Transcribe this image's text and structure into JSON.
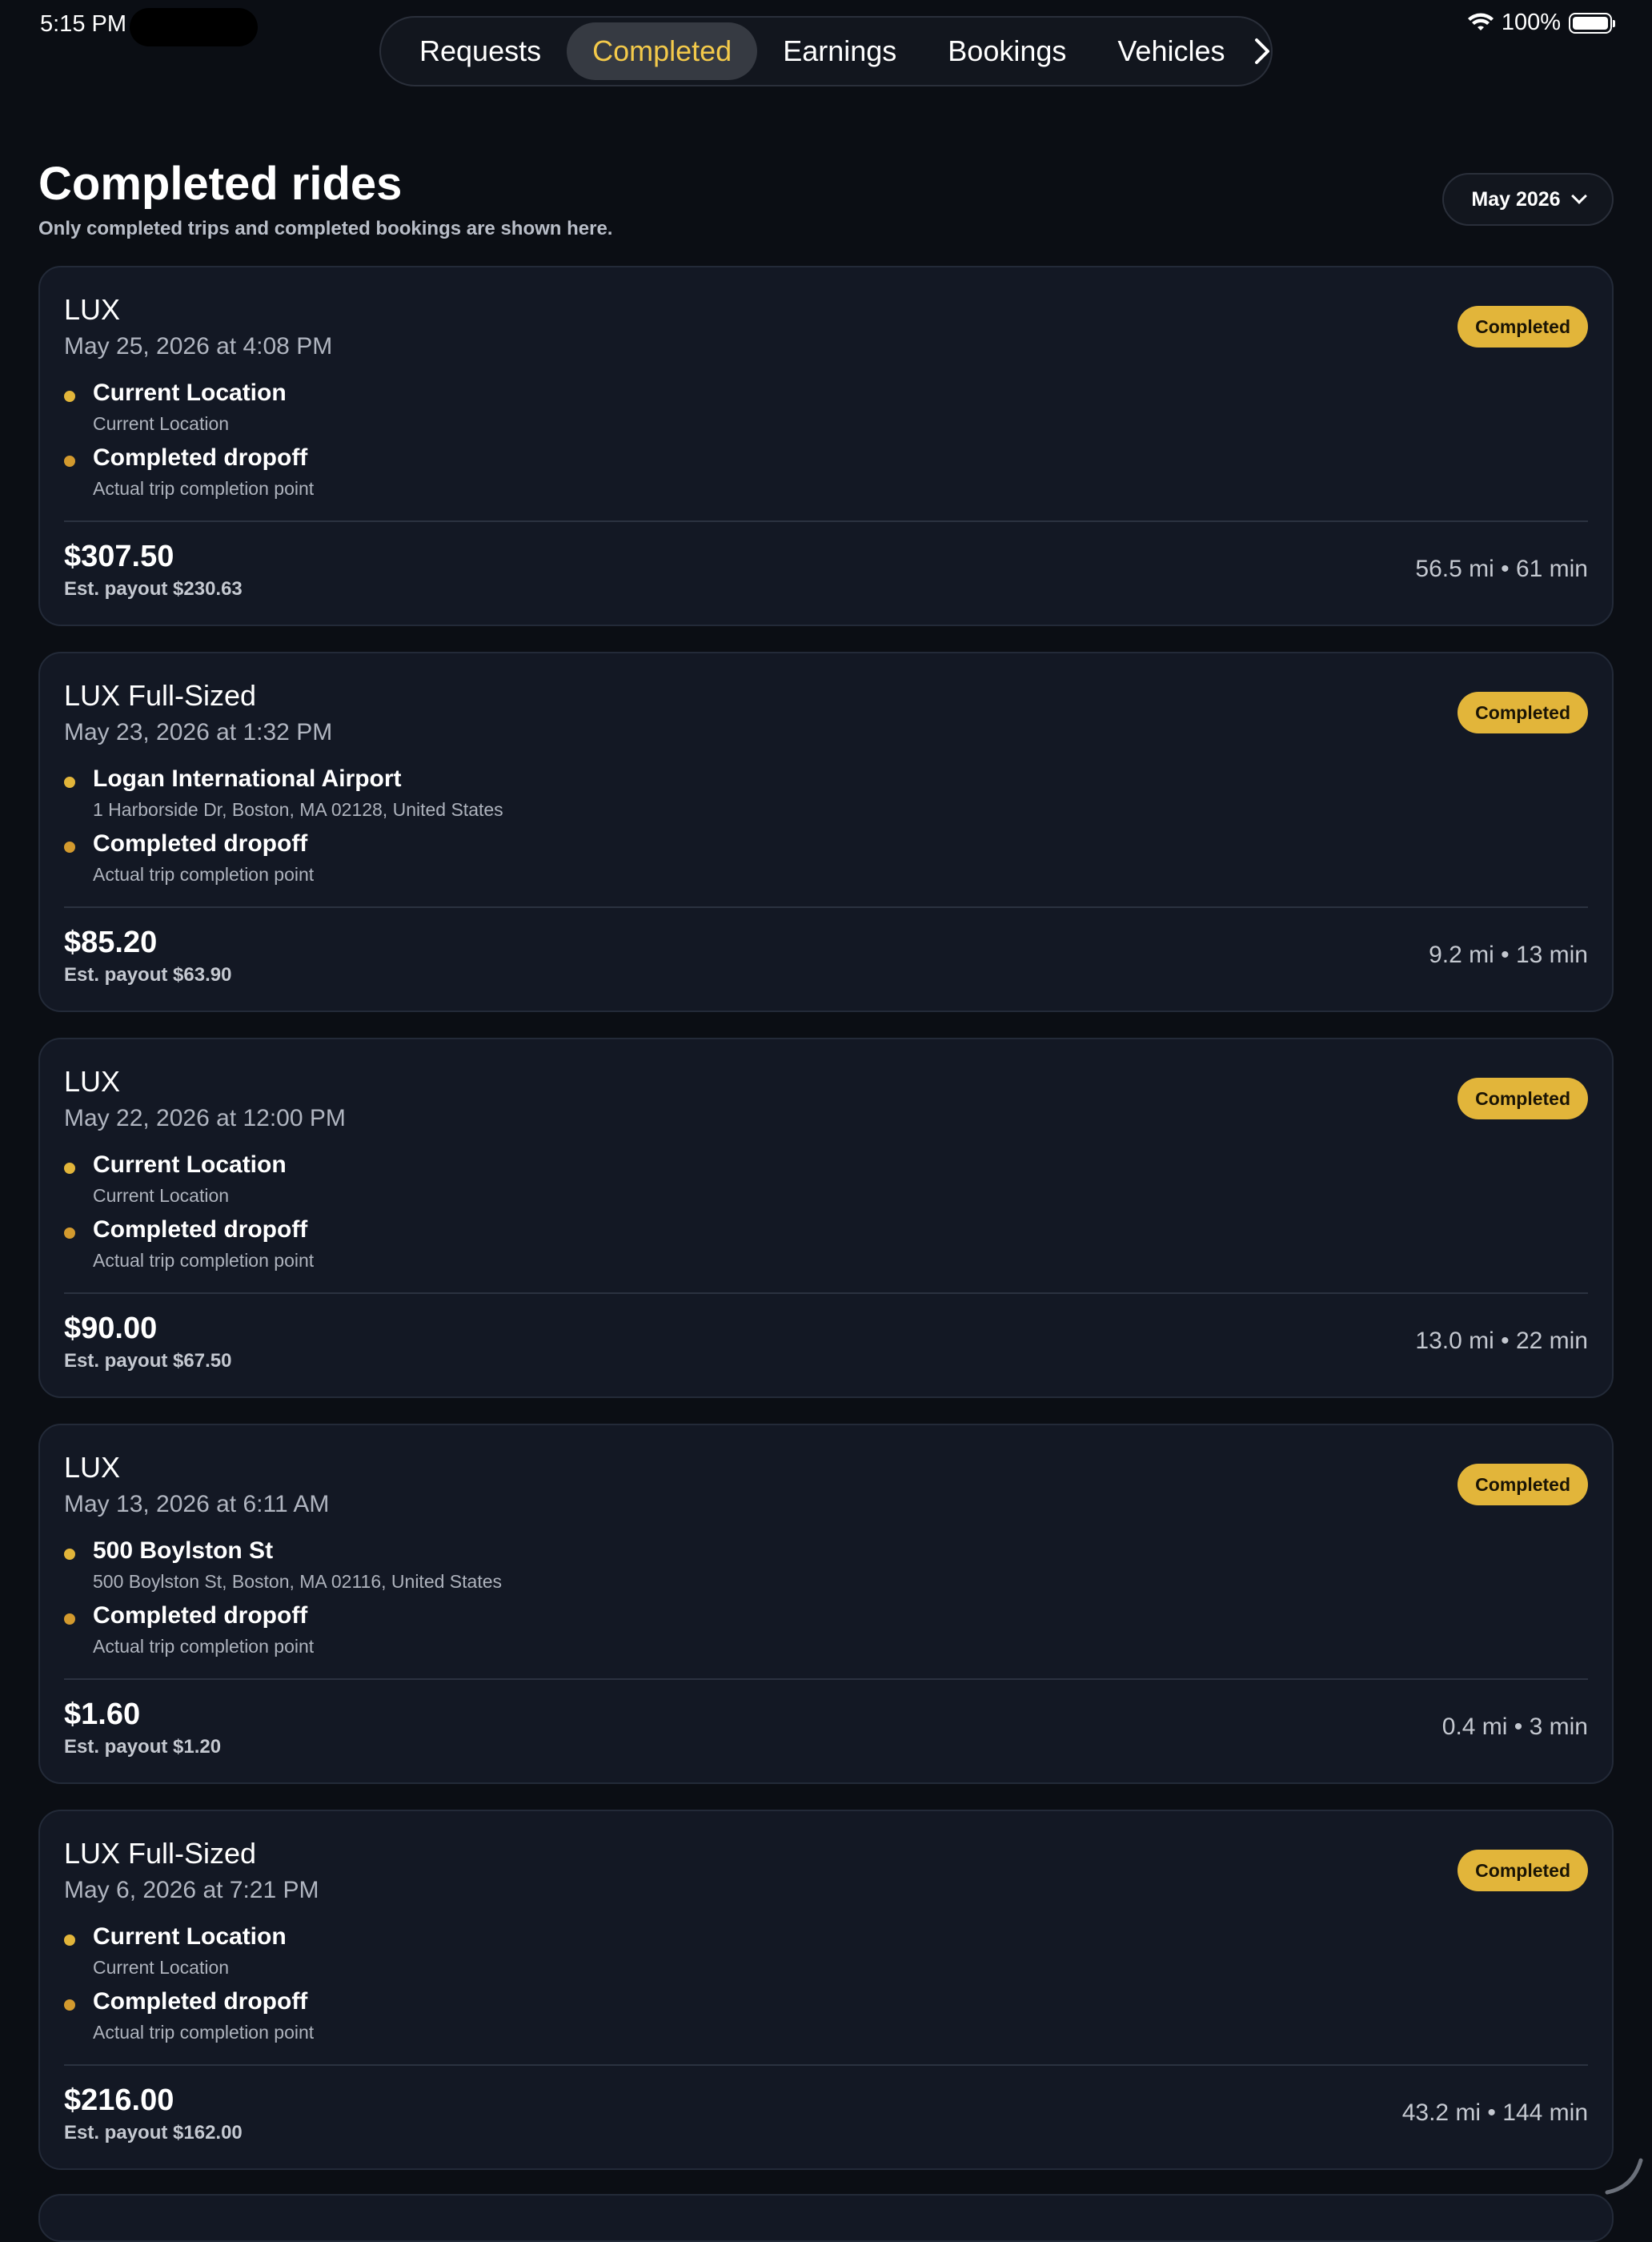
{
  "status_bar": {
    "time": "5:15 PM",
    "battery": "100%"
  },
  "tabs": [
    {
      "label": "Requests",
      "active": false
    },
    {
      "label": "Completed",
      "active": true
    },
    {
      "label": "Earnings",
      "active": false
    },
    {
      "label": "Bookings",
      "active": false
    },
    {
      "label": "Vehicles",
      "active": false
    }
  ],
  "header": {
    "title": "Completed rides",
    "subtitle": "Only completed trips and completed bookings are shown here.",
    "month": "May 2026"
  },
  "rides": [
    {
      "class": "LUX",
      "date": "May 25, 2026 at 4:08 PM",
      "status": "Completed",
      "pickup_name": "Current Location",
      "pickup_sub": "Current Location",
      "dropoff_name": "Completed dropoff",
      "dropoff_sub": "Actual trip completion point",
      "fare": "$307.50",
      "payout": "Est. payout $230.63",
      "meta": "56.5 mi • 61 min"
    },
    {
      "class": "LUX Full-Sized",
      "date": "May 23, 2026 at 1:32 PM",
      "status": "Completed",
      "pickup_name": "Logan International Airport",
      "pickup_sub": "1 Harborside Dr, Boston, MA 02128, United States",
      "dropoff_name": "Completed dropoff",
      "dropoff_sub": "Actual trip completion point",
      "fare": "$85.20",
      "payout": "Est. payout $63.90",
      "meta": "9.2 mi • 13 min"
    },
    {
      "class": "LUX",
      "date": "May 22, 2026 at 12:00 PM",
      "status": "Completed",
      "pickup_name": "Current Location",
      "pickup_sub": "Current Location",
      "dropoff_name": "Completed dropoff",
      "dropoff_sub": "Actual trip completion point",
      "fare": "$90.00",
      "payout": "Est. payout $67.50",
      "meta": "13.0 mi • 22 min"
    },
    {
      "class": "LUX",
      "date": "May 13, 2026 at 6:11 AM",
      "status": "Completed",
      "pickup_name": "500 Boylston St",
      "pickup_sub": "500 Boylston St, Boston, MA  02116, United States",
      "dropoff_name": "Completed dropoff",
      "dropoff_sub": "Actual trip completion point",
      "fare": "$1.60",
      "payout": "Est. payout $1.20",
      "meta": "0.4 mi • 3 min"
    },
    {
      "class": "LUX Full-Sized",
      "date": "May 6, 2026 at 7:21 PM",
      "status": "Completed",
      "pickup_name": "Current Location",
      "pickup_sub": "Current Location",
      "dropoff_name": "Completed dropoff",
      "dropoff_sub": "Actual trip completion point",
      "fare": "$216.00",
      "payout": "Est. payout $162.00",
      "meta": "43.2 mi • 144 min"
    }
  ],
  "icons": {
    "next": "chevron-right-icon",
    "month_dropdown": "chevron-down-icon",
    "wifi": "wifi-icon",
    "battery": "battery-icon"
  },
  "colors": {
    "accent": "#e2b53a",
    "active_tab_text": "#f3c94a",
    "background": "#0b0e14",
    "card": "#131824"
  }
}
